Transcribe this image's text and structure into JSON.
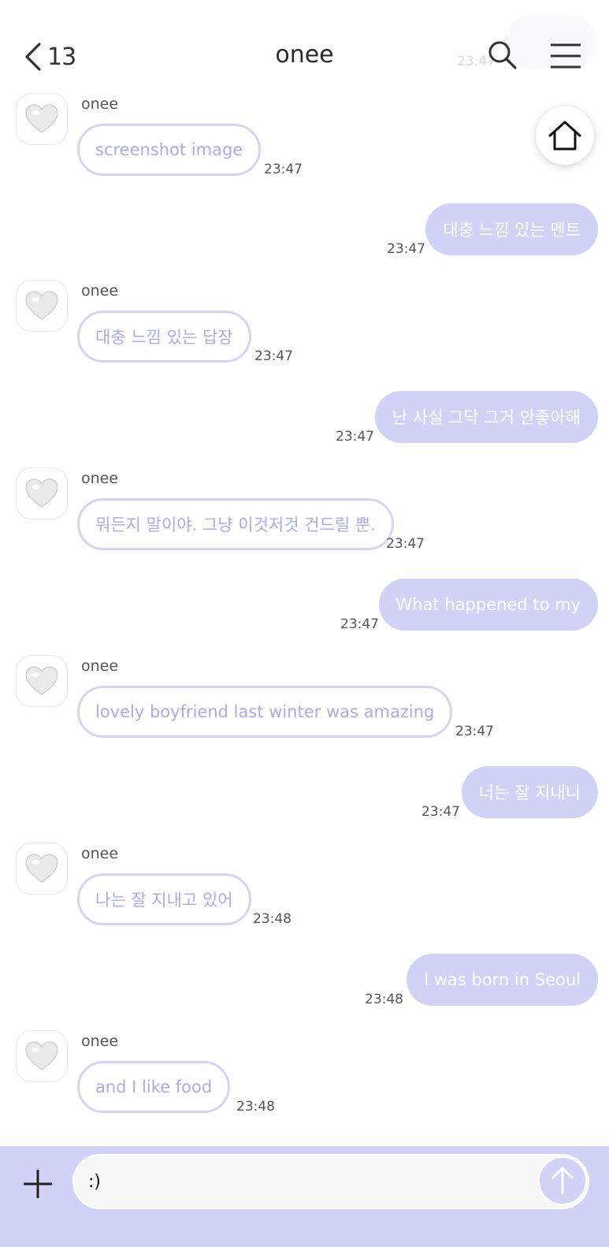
{
  "header": {
    "back_count": "13",
    "title": "onee",
    "back_icon": "chevron-left-icon",
    "search_icon": "search-icon",
    "menu_icon": "hamburger-menu-icon",
    "home_icon": "home-icon"
  },
  "colors": {
    "accent": "#d0d3f6",
    "incoming_border": "#d4d5f3",
    "incoming_text": "#a9abea",
    "outgoing_text": "#ffffff"
  },
  "messages": [
    {
      "from": "onee",
      "text": "screenshot image",
      "time": "23:47"
    },
    {
      "from": "me",
      "text": "대충 느낌 있는 멘트",
      "time": "23:47"
    },
    {
      "from": "onee",
      "text": "대충 느낌 있는 답장",
      "time": "23:47"
    },
    {
      "from": "me",
      "text": "난 사실 그닥 그거 안좋아해",
      "time": "23:47"
    },
    {
      "from": "onee",
      "text": "뭐든지 말이야. 그냥 이것저것 건드릴 뿐.",
      "time": "23:47"
    },
    {
      "from": "me",
      "text": "What happened to my",
      "time": "23:47"
    },
    {
      "from": "onee",
      "text": "lovely boyfriend last winter was amazing",
      "time": "23:47"
    },
    {
      "from": "me",
      "text": "너는 잘 지내니",
      "time": "23:47"
    },
    {
      "from": "onee",
      "text": "나는 잘 지내고 있어",
      "time": "23:48"
    },
    {
      "from": "me",
      "text": "I was born in Seoul",
      "time": "23:48"
    },
    {
      "from": "onee",
      "text": "and I like food",
      "time": "23:48"
    }
  ],
  "composer": {
    "input_value": ":)",
    "plus_icon": "plus-icon",
    "send_icon": "arrow-up-icon"
  }
}
